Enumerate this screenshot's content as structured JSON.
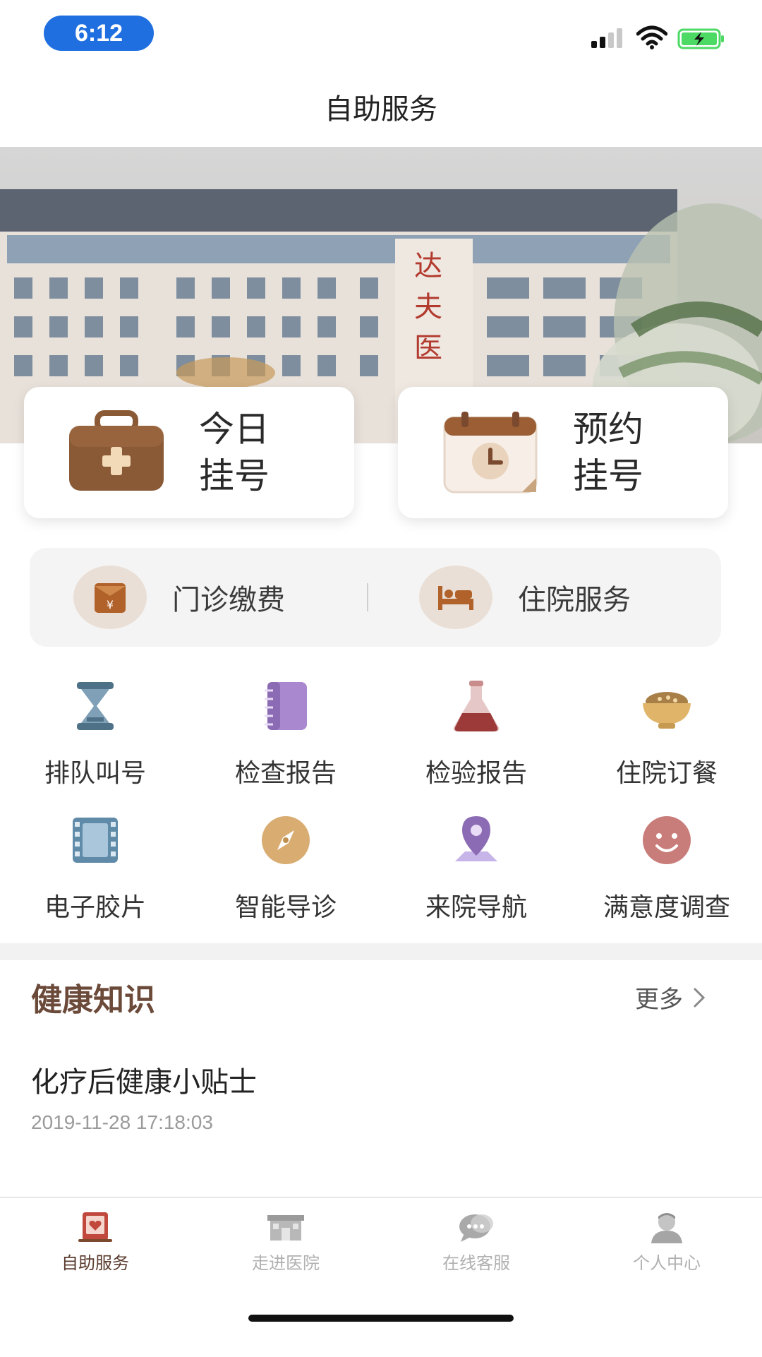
{
  "status_bar": {
    "time": "6:12"
  },
  "header": {
    "title": "自助服务"
  },
  "banner": {
    "signboard_text": "达夫医"
  },
  "quick_cards": [
    {
      "line1": "今日",
      "line2": "挂号",
      "icon": "medical-bag-icon"
    },
    {
      "line1": "预约",
      "line2": "挂号",
      "icon": "calendar-clock-icon"
    }
  ],
  "strip": [
    {
      "label": "门诊缴费",
      "icon": "payment-envelope-icon"
    },
    {
      "label": "住院服务",
      "icon": "hospital-bed-icon"
    }
  ],
  "grid": [
    {
      "label": "排队叫号",
      "icon": "hourglass-icon"
    },
    {
      "label": "检查报告",
      "icon": "report-book-icon"
    },
    {
      "label": "检验报告",
      "icon": "flask-icon"
    },
    {
      "label": "住院订餐",
      "icon": "meal-bowl-icon"
    },
    {
      "label": "电子胶片",
      "icon": "film-icon"
    },
    {
      "label": "智能导诊",
      "icon": "compass-icon"
    },
    {
      "label": "来院导航",
      "icon": "location-pin-icon"
    },
    {
      "label": "满意度调查",
      "icon": "smiley-icon"
    }
  ],
  "health": {
    "title": "健康知识",
    "more_label": "更多",
    "article": {
      "title": "化疗后健康小贴士",
      "time": "2019-11-28 17:18:03"
    }
  },
  "bottom_nav": [
    {
      "label": "自助服务",
      "active": true,
      "icon": "self-service-icon"
    },
    {
      "label": "走进医院",
      "active": false,
      "icon": "hospital-icon"
    },
    {
      "label": "在线客服",
      "active": false,
      "icon": "chat-icon"
    },
    {
      "label": "个人中心",
      "active": false,
      "icon": "user-icon"
    }
  ],
  "colors": {
    "accent_brown": "#7b4a2e",
    "time_pill": "#1f6fe0",
    "battery_green": "#4cd964"
  }
}
